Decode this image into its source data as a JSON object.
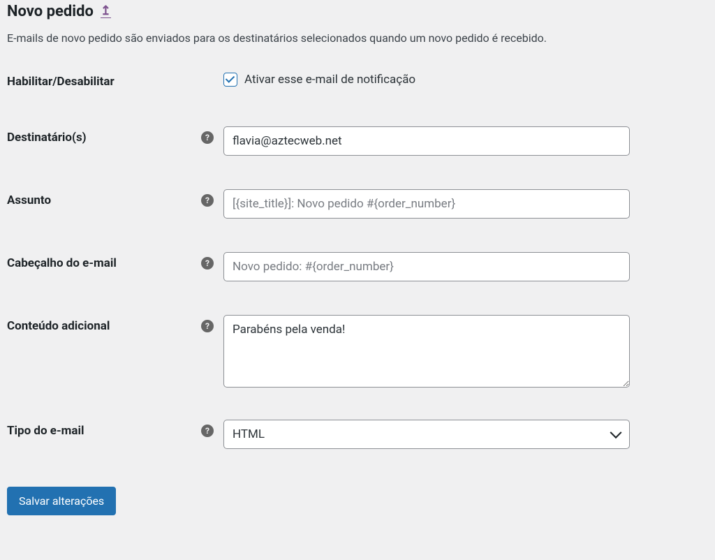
{
  "page": {
    "title": "Novo pedido",
    "back_icon": "↥",
    "description": "E-mails de novo pedido são enviados para os destinatários selecionados quando um novo pedido é recebido."
  },
  "fields": {
    "enable": {
      "label": "Habilitar/Desabilitar",
      "checkbox_label": "Ativar esse e-mail de notificação",
      "checked": true
    },
    "recipient": {
      "label": "Destinatário(s)",
      "value": "flavia@aztecweb.net",
      "placeholder": ""
    },
    "subject": {
      "label": "Assunto",
      "value": "",
      "placeholder": "[{site_title}]: Novo pedido #{order_number}"
    },
    "heading": {
      "label": "Cabeçalho do e-mail",
      "value": "",
      "placeholder": "Novo pedido: #{order_number}"
    },
    "additional": {
      "label": "Conteúdo adicional",
      "value": "Parabéns pela venda!",
      "placeholder": ""
    },
    "type": {
      "label": "Tipo do e-mail",
      "value": "HTML"
    }
  },
  "button": {
    "save": "Salvar alterações"
  },
  "help_glyph": "?"
}
